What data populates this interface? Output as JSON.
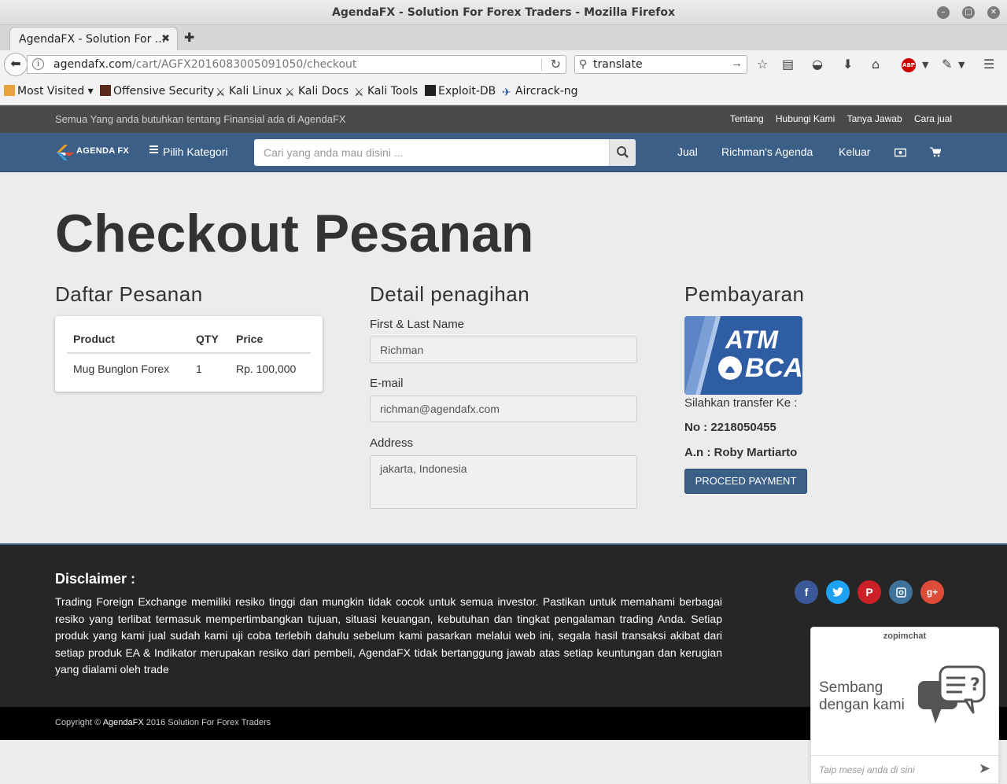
{
  "window": {
    "title": "AgendaFX - Solution For Forex Traders - Mozilla Firefox"
  },
  "browser": {
    "tab_title": "AgendaFX - Solution For ...",
    "tab_close": "✖",
    "new_tab": "✚",
    "url_domain": "agendafx.com",
    "url_path": "/cart/AGFX2016083005091050/checkout",
    "search_value": "translate",
    "bookmarks": [
      "Most Visited ▾",
      "Offensive Security",
      "Kali Linux",
      "Kali Docs",
      "Kali Tools",
      "Exploit-DB",
      "Aircrack-ng"
    ]
  },
  "site": {
    "tagline": "Semua Yang anda butuhkan tentang Finansial ada di AgendaFX",
    "top_links": [
      "Tentang",
      "Hubungi Kami",
      "Tanya Jawab",
      "Cara jual"
    ],
    "logo_text": "AGENDA FX",
    "category_label": "Pilih Kategori",
    "search_placeholder": "Cari yang anda mau disini ...",
    "nav": {
      "sell": "Jual",
      "account": "Richman's Agenda",
      "logout": "Keluar"
    }
  },
  "main": {
    "title": "Checkout Pesanan",
    "order": {
      "heading": "Daftar Pesanan",
      "columns": [
        "Product",
        "QTY",
        "Price"
      ],
      "rows": [
        {
          "product": "Mug Bunglon Forex",
          "qty": "1",
          "price": "Rp. 100,000"
        }
      ]
    },
    "billing": {
      "heading": "Detail penagihan",
      "name_label": "First & Last Name",
      "name_value": "Richman",
      "email_label": "E-mail",
      "email_value": "richman@agendafx.com",
      "address_label": "Address",
      "address_value": "jakarta, Indonesia"
    },
    "payment": {
      "heading": "Pembayaran",
      "card_line1": "ATM",
      "card_line2": "BCA",
      "transfer_label": "Silahkan transfer Ke :",
      "account_no": "No : 2218050455",
      "account_name": "A.n : Roby Martiarto",
      "proceed": "PROCEED PAYMENT"
    }
  },
  "footer": {
    "disclaimer_title": "Disclaimer :",
    "disclaimer_text": "Trading Foreign Exchange memiliki resiko tinggi dan mungkin tidak cocok untuk semua investor. Pastikan untuk memahami berbagai resiko yang terlibat termasuk mempertimbangkan tujuan, situasi keuangan, kebutuhan dan tingkat pengalaman trading Anda. Setiap produk yang kami jual sudah kami uji coba terlebih dahulu sebelum kami pasarkan melalui web ini, segala hasil transaksi akibat dari setiap produk EA & Indikator merupakan resiko dari pembeli, AgendaFX tidak bertanggung jawab atas setiap keuntungan dan kerugian yang dialami oleh trade",
    "copyright_prefix": "Copyright ©",
    "copyright_brand": "AgendaFX",
    "copyright_suffix": "2016 Solution For Forex Traders",
    "social": [
      "facebook-icon",
      "twitter-icon",
      "pinterest-icon",
      "instagram-icon",
      "google-plus-icon"
    ]
  },
  "chat": {
    "brand": "zopimchat",
    "message_line1": "Sembang",
    "message_line2": "dengan kami",
    "input_placeholder": "Taip mesej anda di sini"
  },
  "colors": {
    "navy": "#3b5f86",
    "footer": "#262626",
    "facebook": "#3b5998",
    "twitter": "#1da1f2",
    "pinterest": "#cb2027",
    "instagram": "#3f729b",
    "google_plus": "#dd4b39"
  }
}
